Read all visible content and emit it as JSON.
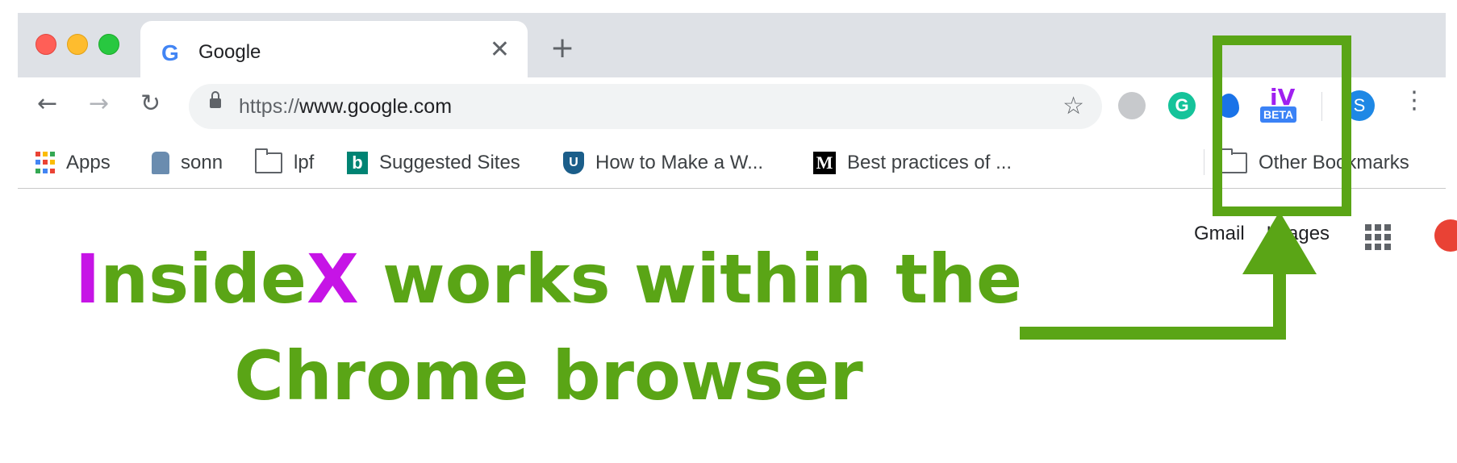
{
  "window": {
    "tab": {
      "favicon": "G",
      "title": "Google",
      "close": "✕"
    },
    "new_tab": "+"
  },
  "toolbar": {
    "back": "←",
    "forward": "→",
    "reload": "↻",
    "url_scheme": "https://",
    "url_host": "www.google.com",
    "bookmark_star": "☆",
    "extensions": {
      "grammarly": "G",
      "insidex_logo": "iV",
      "insidex_badge": "BETA"
    },
    "profile_initial": "S",
    "menu": "⋮"
  },
  "bookmarks": [
    {
      "label": "Apps",
      "icon": "apps-grid-icon"
    },
    {
      "label": "sonn",
      "icon": "person-icon"
    },
    {
      "label": "lpf",
      "icon": "folder-icon"
    },
    {
      "label": "Suggested Sites",
      "icon": "bing-icon"
    },
    {
      "label": "How to Make a W...",
      "icon": "shield-icon"
    },
    {
      "label": "Best practices of ...",
      "icon": "medium-icon"
    }
  ],
  "other_bookmarks": "Other Bookmarks",
  "page": {
    "links": [
      "Gmail",
      "Images"
    ],
    "headline_line1_part1": "Inside",
    "headline_line1_x": "X",
    "headline_line1_rest": " works within the",
    "headline_line2": "Chrome browser"
  },
  "colors": {
    "accent_green": "#5aa516",
    "brand_purple": "#c614e6"
  }
}
